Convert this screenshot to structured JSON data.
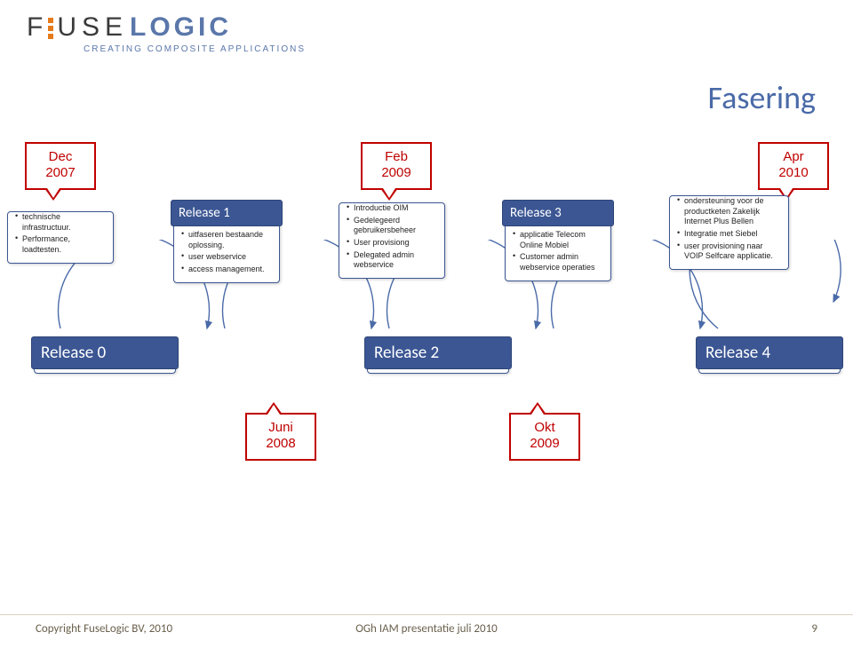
{
  "logo": {
    "brand_fuse": "FUSE",
    "brand_logic": "LOGIC",
    "tagline": "CREATING COMPOSITE APPLICATIONS"
  },
  "title": "Fasering",
  "callouts": {
    "dec2007": {
      "line1": "Dec",
      "line2": "2007"
    },
    "feb2009": {
      "line1": "Feb",
      "line2": "2009"
    },
    "apr2010": {
      "line1": "Apr",
      "line2": "2010"
    },
    "juni2008": {
      "line1": "Juni",
      "line2": "2008"
    },
    "okt2009": {
      "line1": "Okt",
      "line2": "2009"
    }
  },
  "stages": {
    "r0": {
      "title": "Release 0",
      "items": [
        "technische infrastructuur.",
        "Performance, loadtesten."
      ]
    },
    "r1": {
      "title": "Release 1",
      "items": [
        "uitfaseren bestaande oplossing.",
        "user webservice",
        "access management."
      ]
    },
    "r2": {
      "title": "Release 2",
      "items": [
        "Introductie OIM",
        "Gedelegeerd gebruikersbeheer",
        "User provisiong",
        "Delegated admin webservice"
      ]
    },
    "r3": {
      "title": "Release 3",
      "items": [
        "applicatie Telecom Online Mobiel",
        "Customer admin webservice operaties"
      ]
    },
    "r4": {
      "title": "Release 4",
      "items": [
        "ondersteuning voor de productketen Zakelijk Internet Plus Bellen",
        "Integratie met Siebel",
        "user provisioning naar VOIP Selfcare applicatie."
      ]
    }
  },
  "footer": {
    "left": "Copyright FuseLogic BV, 2010",
    "center": "OGh IAM presentatie juli 2010",
    "right": "9"
  }
}
